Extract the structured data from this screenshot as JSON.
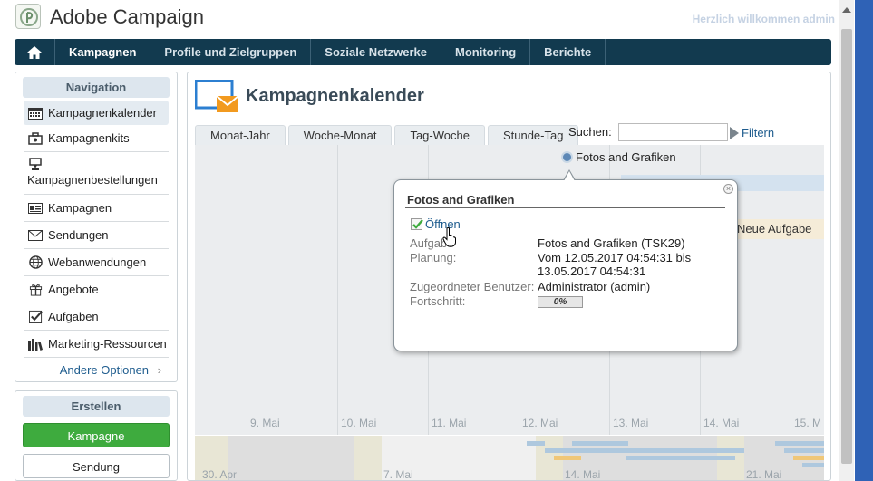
{
  "header": {
    "app_title": "Adobe Campaign",
    "welcome": "Herzlich willkommen admin"
  },
  "topnav": {
    "home_icon": "home-icon",
    "tabs": [
      "Kampagnen",
      "Profile und Zielgruppen",
      "Soziale Netzwerke",
      "Monitoring",
      "Berichte"
    ]
  },
  "sidebar": {
    "title": "Navigation",
    "items": [
      {
        "label": "Kampagnenkalender",
        "icon": "calendar-icon"
      },
      {
        "label": "Kampagnenkits",
        "icon": "kit-icon"
      },
      {
        "label": "Kampagnenbestellungen",
        "icon": "order-icon"
      },
      {
        "label": "Kampagnen",
        "icon": "campaign-icon"
      },
      {
        "label": "Sendungen",
        "icon": "envelope-icon"
      },
      {
        "label": "Webanwendungen",
        "icon": "globe-icon"
      },
      {
        "label": "Angebote",
        "icon": "gift-icon"
      },
      {
        "label": "Aufgaben",
        "icon": "checkbox-icon"
      },
      {
        "label": "Marketing-Ressourcen",
        "icon": "books-icon"
      }
    ],
    "more": "Andere Optionen"
  },
  "create": {
    "title": "Erstellen",
    "campaign_button": "Kampagne",
    "delivery_button": "Sendung"
  },
  "main": {
    "title": "Kampagnenkalender",
    "view_tabs": [
      "Monat-Jahr",
      "Woche-Monat",
      "Tag-Woche",
      "Stunde-Tag"
    ],
    "search_label": "Suchen:",
    "search_value": "",
    "filter_label": "Filtern",
    "day_labels": [
      "9. Mai",
      "10. Mai",
      "11. Mai",
      "12. Mai",
      "13. Mai",
      "14. Mai",
      "15. M"
    ],
    "week_labels": [
      "30. Apr",
      "7. Mai",
      "14. Mai",
      "21. Mai"
    ],
    "task_fotos": "Fotos and Grafiken",
    "task_new": "Neue Aufgabe"
  },
  "popup": {
    "title": "Fotos and Grafiken",
    "open_label": "Öffnen",
    "rows": [
      {
        "label": "Aufgabe",
        "value": "Fotos and Grafiken (TSK29)"
      },
      {
        "label": "Planung:",
        "value": "Vom 12.05.2017 04:54:31 bis 13.05.2017 04:54:31"
      },
      {
        "label": "Zugeordneter Benutzer:",
        "value": "Administrator (admin)"
      },
      {
        "label": "Fortschritt:",
        "value": ""
      }
    ],
    "progress": "0%"
  }
}
